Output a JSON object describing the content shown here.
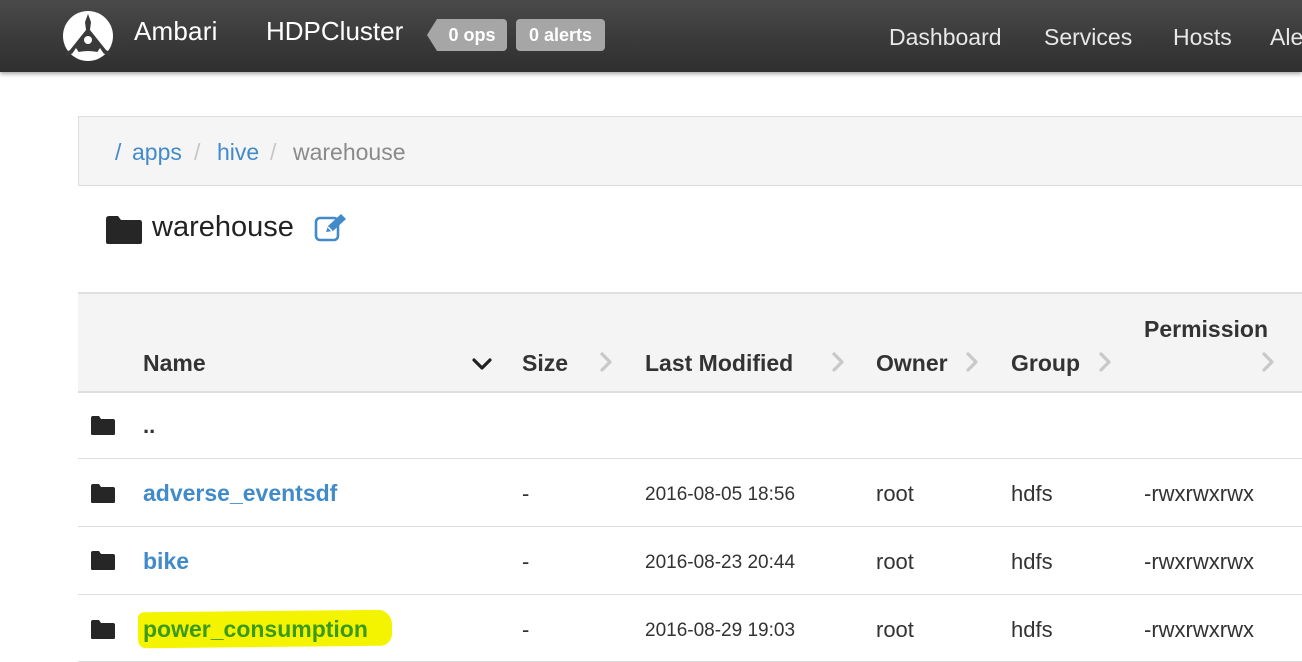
{
  "navbar": {
    "brand": "Ambari",
    "cluster_name": "HDPCluster",
    "ops_badge": "0 ops",
    "alerts_badge": "0 alerts",
    "links": [
      "Dashboard",
      "Services",
      "Hosts",
      "Ale"
    ]
  },
  "breadcrumb": {
    "root_sep": "/",
    "items": [
      "apps",
      "hive"
    ],
    "sep": "/",
    "active": "warehouse"
  },
  "folder": {
    "title": "warehouse",
    "icon": "folder-icon",
    "edit_icon": "edit-icon"
  },
  "table": {
    "columns": [
      "Name",
      "Size",
      "Last Modified",
      "Owner",
      "Group",
      "Permission"
    ],
    "parent_row": "..",
    "rows": [
      {
        "name": "adverse_eventsdf",
        "size": "-",
        "modified": "2016-08-05 18:56",
        "owner": "root",
        "group": "hdfs",
        "permission": "-rwxrwxrwx",
        "highlighted": false
      },
      {
        "name": "bike",
        "size": "-",
        "modified": "2016-08-23 20:44",
        "owner": "root",
        "group": "hdfs",
        "permission": "-rwxrwxrwx",
        "highlighted": false
      },
      {
        "name": "power_consumption",
        "size": "-",
        "modified": "2016-08-29 19:03",
        "owner": "root",
        "group": "hdfs",
        "permission": "-rwxrwxrwx",
        "highlighted": true
      }
    ]
  },
  "colors": {
    "link": "#428bca",
    "highlight": "#f4f400",
    "highlight_text": "#3c9a1a",
    "navbar": "#3a3a3a"
  }
}
